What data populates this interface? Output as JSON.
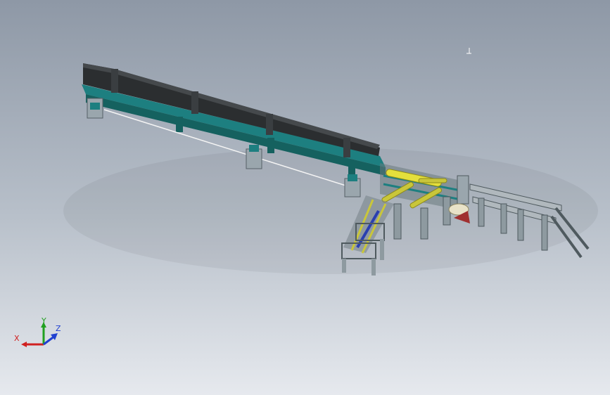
{
  "viewport": {
    "background_top": "#8e98a6",
    "background_bottom": "#e6e9ee"
  },
  "model": {
    "beam_color": "#2b2e30",
    "frame_color": "#1d7f80",
    "cradle_color": "#c9c63a",
    "stand_color": "#9aa6ad",
    "motor_color": "#e8e2c8",
    "saw_color": "#a03030"
  },
  "triad": {
    "x_label": "X",
    "y_label": "Y",
    "z_label": "Z",
    "x_color": "#d02020",
    "y_color": "#20a020",
    "z_color": "#2040d0"
  },
  "reference_marker": {
    "icon": "coordinate-origin-icon"
  }
}
